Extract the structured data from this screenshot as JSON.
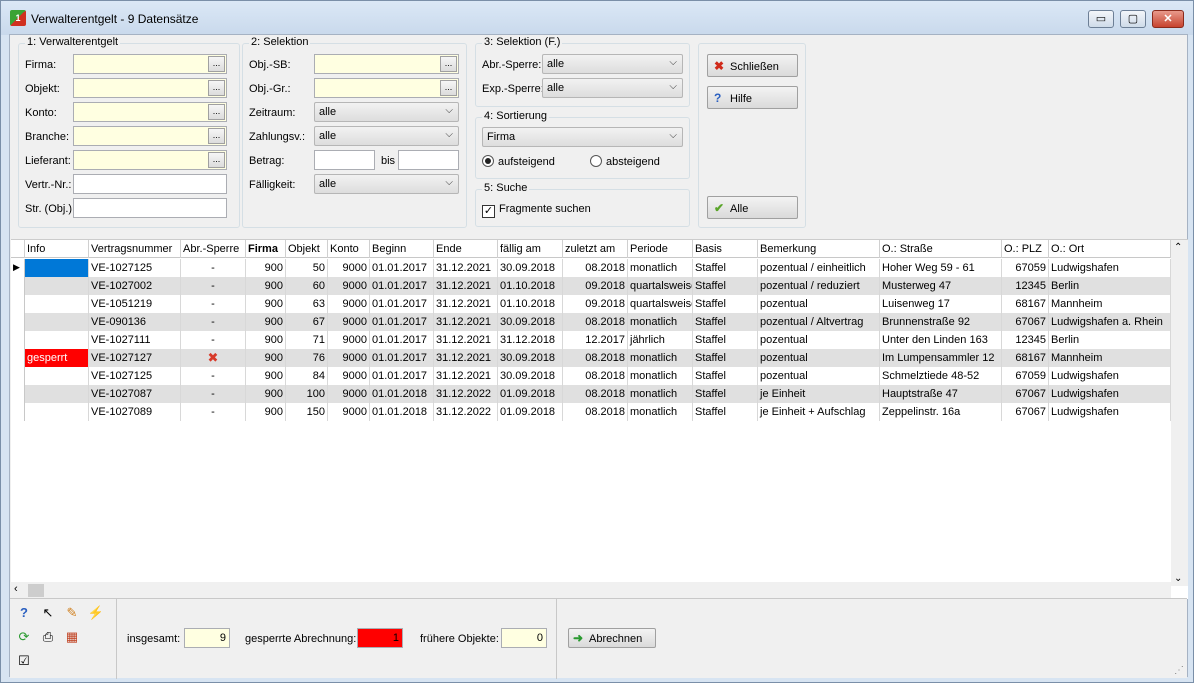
{
  "window": {
    "title": "Verwalterentgelt - 9 Datensätze",
    "min": "▭",
    "max": "▢",
    "close": "✕"
  },
  "group1": {
    "title": "1: Verwalterentgelt",
    "labels": [
      "Firma:",
      "Objekt:",
      "Konto:",
      "Branche:",
      "Lieferant:",
      "Vertr.-Nr.:",
      "Str. (Obj.):"
    ],
    "dots": "..."
  },
  "group2": {
    "title": "2: Selektion",
    "objsb": "Obj.-SB:",
    "objgr": "Obj.-Gr.:",
    "zeitraum_label": "Zeitraum:",
    "zeitraum_value": "alle",
    "zahlungsv_label": "Zahlungsv.:",
    "zahlungsv_value": "alle",
    "betrag_label": "Betrag:",
    "bis_label": "bis",
    "faelligkeit_label": "Fälligkeit:",
    "faelligkeit_value": "alle"
  },
  "group3": {
    "title": "3: Selektion (F.)",
    "abr_label": "Abr.-Sperre:",
    "abr_value": "alle",
    "exp_label": "Exp.-Sperre:",
    "exp_value": "alle"
  },
  "group4": {
    "title": "4: Sortierung",
    "sort_value": "Firma",
    "asc_label": "aufsteigend",
    "desc_label": "absteigend"
  },
  "group5": {
    "title": "5: Suche",
    "fragments_label": "Fragmente suchen"
  },
  "actions": {
    "close_label": "Schließen",
    "help_label": "Hilfe",
    "all_label": "Alle"
  },
  "grid": {
    "headers": [
      "Info",
      "Vertragsnummer",
      "Abr.-Sperre",
      "Firma",
      "Objekt",
      "Konto",
      "Beginn",
      "Ende",
      "fällig am",
      "zuletzt am",
      "Periode",
      "Basis",
      "Bemerkung",
      "O.: Straße",
      "O.: PLZ",
      "O.: Ort"
    ],
    "rows": [
      [
        "",
        "VE-1027125",
        "-",
        "900",
        "50",
        "9000",
        "01.01.2017",
        "31.12.2021",
        "30.09.2018",
        "08.2018",
        "monatlich",
        "Staffel",
        "pozentual / einheitlich",
        "Hoher Weg 59 - 61",
        "67059",
        "Ludwigshafen"
      ],
      [
        "",
        "VE-1027002",
        "-",
        "900",
        "60",
        "9000",
        "01.01.2017",
        "31.12.2021",
        "01.10.2018",
        "09.2018",
        "quartalsweise",
        "Staffel",
        "pozentual / reduziert",
        "Musterweg 47",
        "12345",
        "Berlin"
      ],
      [
        "",
        "VE-1051219",
        "-",
        "900",
        "63",
        "9000",
        "01.01.2017",
        "31.12.2021",
        "01.10.2018",
        "09.2018",
        "quartalsweise",
        "Staffel",
        "pozentual",
        "Luisenweg 17",
        "68167",
        "Mannheim"
      ],
      [
        "",
        "VE-090136",
        "-",
        "900",
        "67",
        "9000",
        "01.01.2017",
        "31.12.2021",
        "30.09.2018",
        "08.2018",
        "monatlich",
        "Staffel",
        "pozentual / Altvertrag",
        "Brunnenstraße 92",
        "67067",
        "Ludwigshafen a. Rhein"
      ],
      [
        "",
        "VE-1027111",
        "-",
        "900",
        "71",
        "9000",
        "01.01.2017",
        "31.12.2021",
        "31.12.2018",
        "12.2017",
        "jährlich",
        "Staffel",
        "pozentual",
        "Unter den Linden 163",
        "12345",
        "Berlin"
      ],
      [
        "gesperrt",
        "VE-1027127",
        "✖",
        "900",
        "76",
        "9000",
        "01.01.2017",
        "31.12.2021",
        "30.09.2018",
        "08.2018",
        "monatlich",
        "Staffel",
        "pozentual",
        "Im Lumpensammler 12",
        "68167",
        "Mannheim"
      ],
      [
        "",
        "VE-1027125",
        "-",
        "900",
        "84",
        "9000",
        "01.01.2017",
        "31.12.2021",
        "30.09.2018",
        "08.2018",
        "monatlich",
        "Staffel",
        "pozentual",
        "Schmelztiede 48-52",
        "67059",
        "Ludwigshafen"
      ],
      [
        "",
        "VE-1027087",
        "-",
        "900",
        "100",
        "9000",
        "01.01.2018",
        "31.12.2022",
        "01.09.2018",
        "08.2018",
        "monatlich",
        "Staffel",
        "je Einheit",
        "Hauptstraße 47",
        "67067",
        "Ludwigshafen"
      ],
      [
        "",
        "VE-1027089",
        "-",
        "900",
        "150",
        "9000",
        "01.01.2018",
        "31.12.2022",
        "01.09.2018",
        "08.2018",
        "monatlich",
        "Staffel",
        "je Einheit + Aufschlag",
        "Zeppelinstr. 16a",
        "67067",
        "Ludwigshafen"
      ]
    ]
  },
  "footer": {
    "total_label": "insgesamt:",
    "total_value": "9",
    "locked_label": "gesperrte Abrechnung:",
    "locked_value": "1",
    "earlier_label": "frühere Objekte:",
    "earlier_value": "0",
    "abrechnen_label": "Abrechnen"
  },
  "colors": {
    "locked": "#ff0000",
    "selected_info": "#0078d7",
    "field_yellow": "#ffffe1"
  }
}
